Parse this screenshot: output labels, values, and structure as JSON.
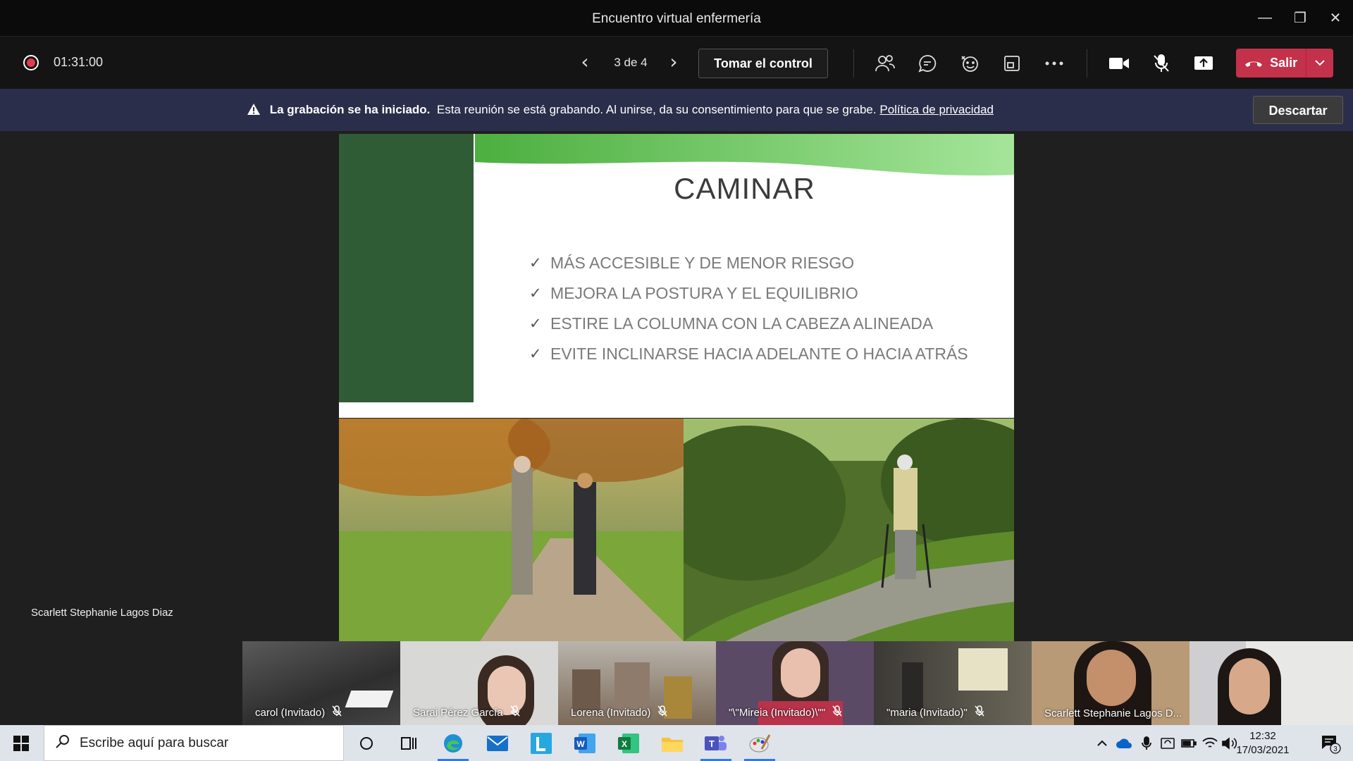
{
  "window": {
    "title": "Encuentro virtual enfermería",
    "minimize": "—",
    "restore": "❐",
    "close": "✕"
  },
  "toolbar": {
    "timer": "01:31:00",
    "prev": "‹",
    "page": "3 de 4",
    "next": "›",
    "take_control": "Tomar el control",
    "leave": "Salir",
    "accent": "#c4314b"
  },
  "banner": {
    "bold": "La grabación se ha iniciado.",
    "text": "Esta reunión se está grabando. Al unirse, da su consentimiento para que se grabe.",
    "link": "Política de privacidad",
    "dismiss": "Descartar"
  },
  "slide": {
    "title": "CAMINAR",
    "check": "✓",
    "bullets": [
      "MÁS ACCESIBLE Y DE MENOR RIESGO",
      "MEJORA LA POSTURA Y EL EQUILIBRIO",
      "ESTIRE LA COLUMNA CON LA CABEZA ALINEADA",
      "EVITE INCLINARSE HACIA ADELANTE O HACIA ATRÁS"
    ]
  },
  "presenter": {
    "name": "Scarlett Stephanie Lagos Diaz"
  },
  "participants": [
    {
      "name": "carol (Invitado)"
    },
    {
      "name": "Sarai Pérez García"
    },
    {
      "name": "Lorena (Invitado)"
    },
    {
      "name": "\"\\\"Mireia (Invitado)\\\"\""
    },
    {
      "name": "\"maria (Invitado)\""
    },
    {
      "name": "Scarlett Stephanie Lagos D..."
    },
    {
      "name": ""
    }
  ],
  "taskbar": {
    "search_placeholder": "Escribe aquí para buscar",
    "time": "12:32",
    "date": "17/03/2021",
    "notifications": "3"
  }
}
